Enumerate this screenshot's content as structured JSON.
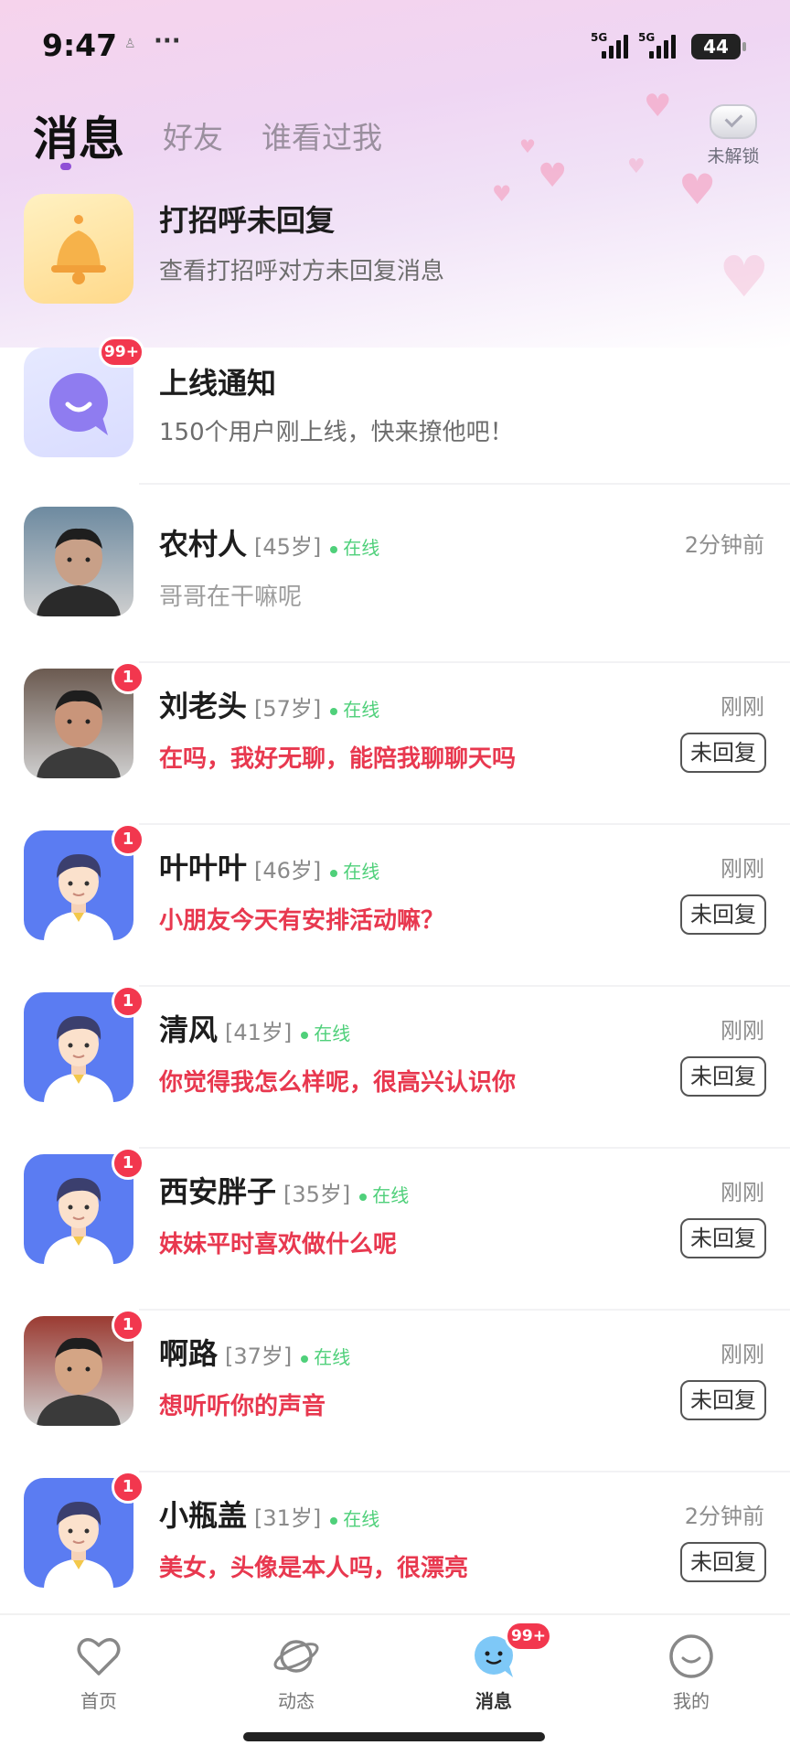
{
  "status_bar": {
    "time": "9:47",
    "dots": "···",
    "net1": "5G",
    "net2": "5G",
    "battery": "44"
  },
  "tabs": {
    "active": "消息",
    "friends": "好友",
    "viewers": "谁看过我"
  },
  "unlock": {
    "label": "未解锁"
  },
  "greeting": {
    "title": "打招呼未回复",
    "subtitle": "查看打招呼对方未回复消息"
  },
  "online_notice": {
    "badge": "99+",
    "title": "上线通知",
    "subtitle": "150个用户刚上线，快来撩他吧！"
  },
  "online_label": "在线",
  "reply_label": "未回复",
  "chats": [
    {
      "name": "农村人",
      "age": "[45岁]",
      "time": "2分钟前",
      "message": "哥哥在干嘛呢",
      "badge": "",
      "unreplied": false,
      "avatar": "photo-1"
    },
    {
      "name": "刘老头",
      "age": "[57岁]",
      "time": "刚刚",
      "message": "在吗，我好无聊，能陪我聊聊天吗",
      "badge": "1",
      "unreplied": true,
      "avatar": "photo-2"
    },
    {
      "name": "叶叶叶",
      "age": "[46岁]",
      "time": "刚刚",
      "message": "小朋友今天有安排活动嘛？",
      "badge": "1",
      "unreplied": true,
      "avatar": "default"
    },
    {
      "name": "清风",
      "age": "[41岁]",
      "time": "刚刚",
      "message": "你觉得我怎么样呢，很高兴认识你",
      "badge": "1",
      "unreplied": true,
      "avatar": "default"
    },
    {
      "name": "西安胖子",
      "age": "[35岁]",
      "time": "刚刚",
      "message": "妹妹平时喜欢做什么呢",
      "badge": "1",
      "unreplied": true,
      "avatar": "default"
    },
    {
      "name": "啊路",
      "age": "[37岁]",
      "time": "刚刚",
      "message": "想听听你的声音",
      "badge": "1",
      "unreplied": true,
      "avatar": "photo-3"
    },
    {
      "name": "小瓶盖",
      "age": "[31岁]",
      "time": "2分钟前",
      "message": "美女，头像是本人吗，很漂亮",
      "badge": "1",
      "unreplied": true,
      "avatar": "default"
    }
  ],
  "bottom_nav": {
    "home": "首页",
    "moments": "动态",
    "messages": "消息",
    "messages_badge": "99+",
    "mine": "我的"
  },
  "colors": {
    "accent": "#8f4fd6",
    "badge": "#f2374e",
    "online": "#4fd07a",
    "unread_text": "#e8384f",
    "default_avatar_bg": "#5b7cf2"
  }
}
